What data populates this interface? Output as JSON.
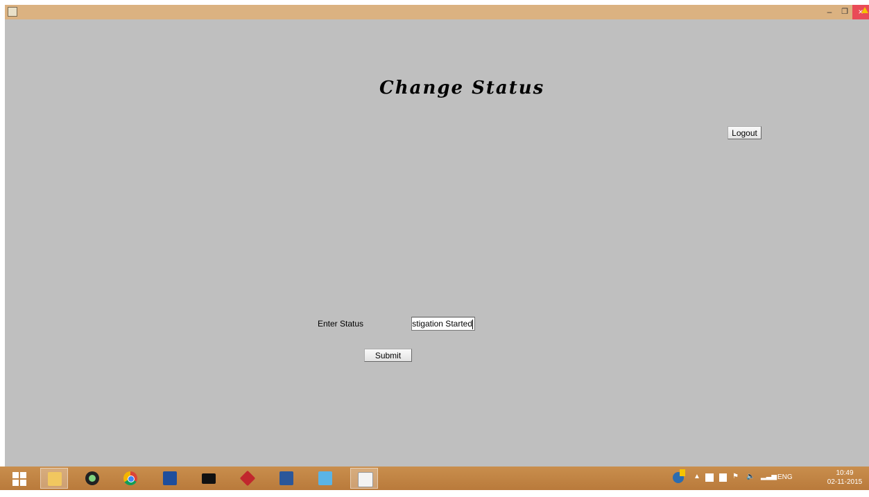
{
  "window": {
    "minimize_label": "–",
    "maximize_label": "❐",
    "close_label": "×"
  },
  "main": {
    "heading": "Change Status",
    "logout_label": "Logout",
    "status_label": "Enter Status",
    "status_value": "stigation Started",
    "submit_label": "Submit"
  },
  "taskbar": {
    "items": [
      "start",
      "file-explorer",
      "camera-app",
      "chrome",
      "dev-cpp",
      "command-prompt",
      "app-red",
      "word",
      "app-blue",
      "java"
    ],
    "tray_lang": "ENG",
    "time": "10:49",
    "date": "02-11-2015"
  }
}
